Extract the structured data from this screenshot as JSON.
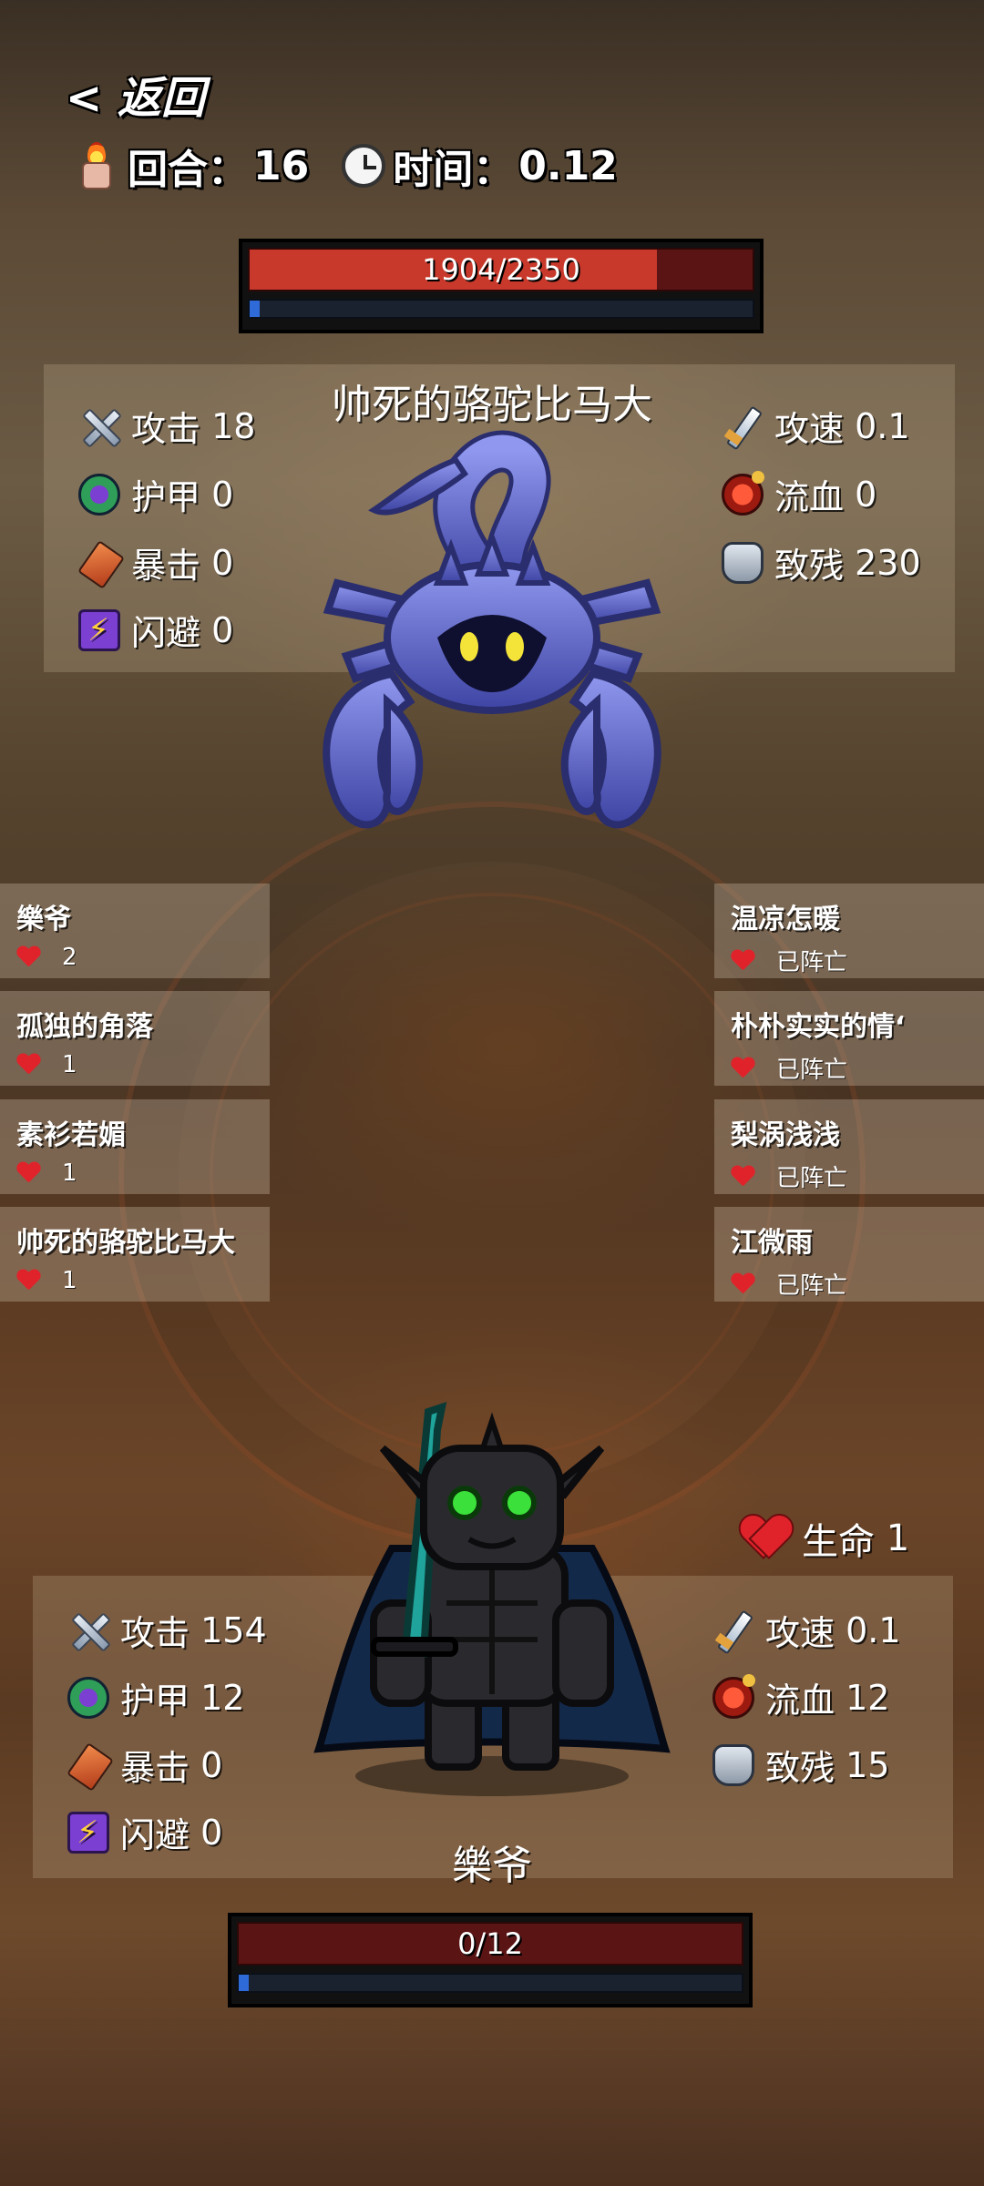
{
  "header": {
    "back_label": "< 返回",
    "round_label": "回合：",
    "round_value": "16",
    "time_label": "时间：",
    "time_value": "0.12"
  },
  "boss": {
    "name": "帅死的骆驼比马大",
    "hp_text": "1904/2350",
    "hp_fraction": 0.81,
    "energy_fraction": 0.02,
    "stats_left": [
      {
        "label": "攻击",
        "value": "18",
        "icon": "attack-icon"
      },
      {
        "label": "护甲",
        "value": "0",
        "icon": "armor-icon"
      },
      {
        "label": "暴击",
        "value": "0",
        "icon": "crit-icon"
      },
      {
        "label": "闪避",
        "value": "0",
        "icon": "dodge-icon"
      }
    ],
    "stats_right": [
      {
        "label": "攻速",
        "value": "0.1",
        "icon": "attack-speed-icon"
      },
      {
        "label": "流血",
        "value": "0",
        "icon": "bleed-icon"
      },
      {
        "label": "致残",
        "value": "230",
        "icon": "maim-icon"
      }
    ]
  },
  "players_left": [
    {
      "name": "樂爷",
      "status": "2"
    },
    {
      "name": "孤独的角落",
      "status": "1"
    },
    {
      "name": "素衫若媚",
      "status": "1"
    },
    {
      "name": "帅死的骆驼比马大",
      "status": "1"
    }
  ],
  "players_right": [
    {
      "name": "温凉怎暖",
      "status": "已阵亡"
    },
    {
      "name": "朴朴实实的情ʻ",
      "status": "已阵亡"
    },
    {
      "name": "梨涡浅浅",
      "status": "已阵亡"
    },
    {
      "name": "江微雨",
      "status": "已阵亡"
    }
  ],
  "hero": {
    "name": "樂爷",
    "life_label": "生命",
    "life_value": "1",
    "hp_text": "0/12",
    "hp_fraction": 0,
    "energy_fraction": 0.02,
    "stats_left": [
      {
        "label": "攻击",
        "value": "154",
        "icon": "attack-icon"
      },
      {
        "label": "护甲",
        "value": "12",
        "icon": "armor-icon"
      },
      {
        "label": "暴击",
        "value": "0",
        "icon": "crit-icon"
      },
      {
        "label": "闪避",
        "value": "0",
        "icon": "dodge-icon"
      }
    ],
    "stats_right": [
      {
        "label": "攻速",
        "value": "0.1",
        "icon": "attack-speed-icon"
      },
      {
        "label": "流血",
        "value": "12",
        "icon": "bleed-icon"
      },
      {
        "label": "致残",
        "value": "15",
        "icon": "maim-icon"
      }
    ]
  },
  "colors": {
    "hp_fill": "#c8392b",
    "hp_empty": "#5a1414",
    "energy": "#2f6bd8",
    "scorpion": "#5b63c9",
    "hero_armor": "#2a2a2e",
    "hero_eyes": "#3be03a",
    "hero_sword": "#1fa39a"
  }
}
